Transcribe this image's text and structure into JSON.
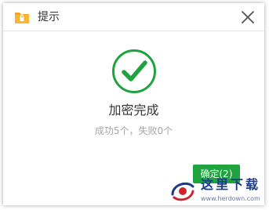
{
  "dialog": {
    "title": "提示",
    "main_message": "加密完成",
    "sub_message": "成功5个，失败0个",
    "ok_button_label": "确定(2)"
  },
  "icons": {
    "app": "folder-lock-icon",
    "close": "close-icon",
    "status": "success-check-icon"
  },
  "watermark": {
    "title": "这里下载",
    "url": "www.herdown.com"
  },
  "colors": {
    "accent_green": "#1fa33f",
    "folder_orange": "#f5a623",
    "title_text": "#333333",
    "secondary_text": "#a6a6a6"
  }
}
